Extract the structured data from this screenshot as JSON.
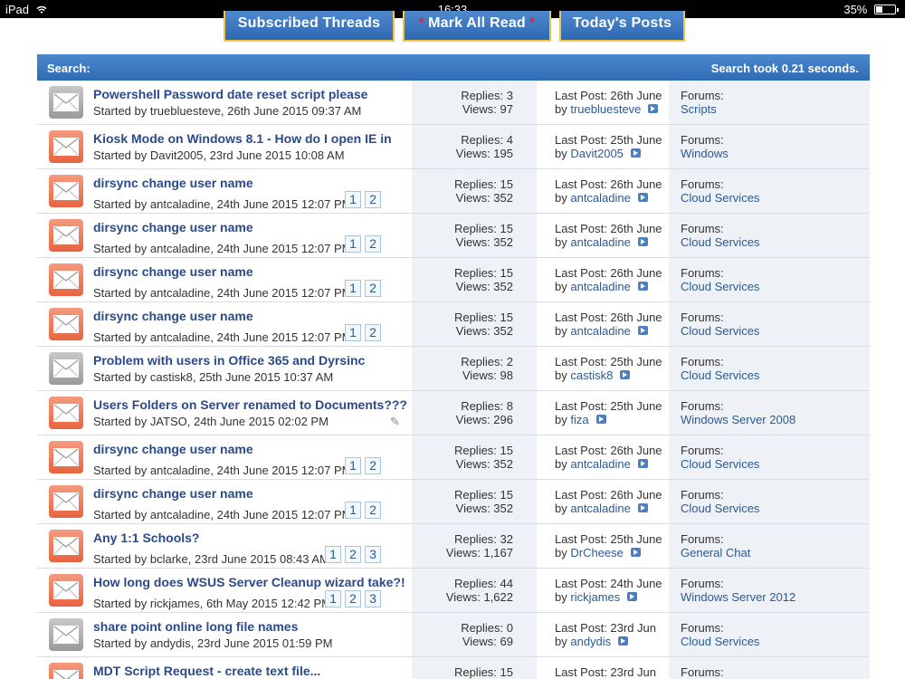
{
  "status_bar": {
    "device": "iPad",
    "time": "16:33",
    "battery": "35%",
    "battery_level": 0.35
  },
  "buttons": {
    "subscribed": "Subscribed Threads",
    "mark_all_read": "Mark All Read",
    "todays_posts": "Today's Posts"
  },
  "search_header": {
    "label": "Search:",
    "took": "Search took 0.21 seconds."
  },
  "labels": {
    "forums": "Forums:"
  },
  "threads": [
    {
      "title": "Powershell Password date reset script please",
      "started": "Started by truebluesteve, 26th June 2015 09:37 AM",
      "replies": "Replies: 3",
      "views": "Views: 97",
      "last_post": "Last Post: 26th June",
      "by": "by",
      "user": "truebluesteve",
      "forum": "Scripts",
      "icon": "cold",
      "pages": []
    },
    {
      "title": "Kiosk Mode on Windows 8.1 - How do I open IE in",
      "started": "Started by Davit2005, 23rd June 2015 10:08 AM",
      "replies": "Replies: 4",
      "views": "Views: 195",
      "last_post": "Last Post: 25th June",
      "by": "by",
      "user": "Davit2005",
      "forum": "Windows",
      "icon": "hot",
      "pages": []
    },
    {
      "title": "dirsync change user name",
      "started": "Started by antcaladine, 24th June 2015 12:07 PM",
      "replies": "Replies: 15",
      "views": "Views: 352",
      "last_post": "Last Post: 26th June",
      "by": "by",
      "user": "antcaladine",
      "forum": "Cloud Services",
      "icon": "hot",
      "pages": [
        "1",
        "2"
      ]
    },
    {
      "title": "dirsync change user name",
      "started": "Started by antcaladine, 24th June 2015 12:07 PM",
      "replies": "Replies: 15",
      "views": "Views: 352",
      "last_post": "Last Post: 26th June",
      "by": "by",
      "user": "antcaladine",
      "forum": "Cloud Services",
      "icon": "hot",
      "pages": [
        "1",
        "2"
      ]
    },
    {
      "title": "dirsync change user name",
      "started": "Started by antcaladine, 24th June 2015 12:07 PM",
      "replies": "Replies: 15",
      "views": "Views: 352",
      "last_post": "Last Post: 26th June",
      "by": "by",
      "user": "antcaladine",
      "forum": "Cloud Services",
      "icon": "hot",
      "pages": [
        "1",
        "2"
      ]
    },
    {
      "title": "dirsync change user name",
      "started": "Started by antcaladine, 24th June 2015 12:07 PM",
      "replies": "Replies: 15",
      "views": "Views: 352",
      "last_post": "Last Post: 26th June",
      "by": "by",
      "user": "antcaladine",
      "forum": "Cloud Services",
      "icon": "hot",
      "pages": [
        "1",
        "2"
      ]
    },
    {
      "title": "Problem with users in Office 365 and Dyrsinc",
      "started": "Started by castisk8, 25th June 2015 10:37 AM",
      "replies": "Replies: 2",
      "views": "Views: 98",
      "last_post": "Last Post: 25th June",
      "by": "by",
      "user": "castisk8",
      "forum": "Cloud Services",
      "icon": "cold",
      "pages": []
    },
    {
      "title": "Users Folders on Server renamed to Documents???",
      "started": "Started by JATSO, 24th June 2015 02:02 PM",
      "replies": "Replies: 8",
      "views": "Views: 296",
      "last_post": "Last Post: 25th June",
      "by": "by",
      "user": "fiza",
      "forum": "Windows Server 2008",
      "icon": "hot",
      "pages": [],
      "attachment": true
    },
    {
      "title": "dirsync change user name",
      "started": "Started by antcaladine, 24th June 2015 12:07 PM",
      "replies": "Replies: 15",
      "views": "Views: 352",
      "last_post": "Last Post: 26th June",
      "by": "by",
      "user": "antcaladine",
      "forum": "Cloud Services",
      "icon": "hot",
      "pages": [
        "1",
        "2"
      ]
    },
    {
      "title": "dirsync change user name",
      "started": "Started by antcaladine, 24th June 2015 12:07 PM",
      "replies": "Replies: 15",
      "views": "Views: 352",
      "last_post": "Last Post: 26th June",
      "by": "by",
      "user": "antcaladine",
      "forum": "Cloud Services",
      "icon": "hot",
      "pages": [
        "1",
        "2"
      ]
    },
    {
      "title": "Any 1:1 Schools?",
      "started": "Started by bclarke, 23rd June 2015 08:43 AM",
      "replies": "Replies: 32",
      "views": "Views: 1,167",
      "last_post": "Last Post: 25th June",
      "by": "by",
      "user": "DrCheese",
      "forum": "General Chat",
      "icon": "hot",
      "pages": [
        "1",
        "2",
        "3"
      ]
    },
    {
      "title": "How long does WSUS Server Cleanup wizard take?!",
      "started": "Started by rickjames, 6th May 2015 12:42 PM",
      "replies": "Replies: 44",
      "views": "Views: 1,622",
      "last_post": "Last Post: 24th June",
      "by": "by",
      "user": "rickjames",
      "forum": "Windows Server 2012",
      "icon": "hot",
      "pages": [
        "1",
        "2",
        "3"
      ]
    },
    {
      "title": "share point online long file names",
      "started": "Started by andydis, 23rd June 2015 01:59 PM",
      "replies": "Replies: 0",
      "views": "Views: 69",
      "last_post": "Last Post: 23rd Jun",
      "by": "by",
      "user": "andydis",
      "forum": "Cloud Services",
      "icon": "cold",
      "pages": []
    },
    {
      "title": "MDT Script Request - create text file...",
      "started": "",
      "replies": "Replies: 15",
      "views": "",
      "last_post": "Last Post: 23rd Jun",
      "by": "by",
      "user": "",
      "forum": "",
      "icon": "hot",
      "pages": []
    }
  ]
}
